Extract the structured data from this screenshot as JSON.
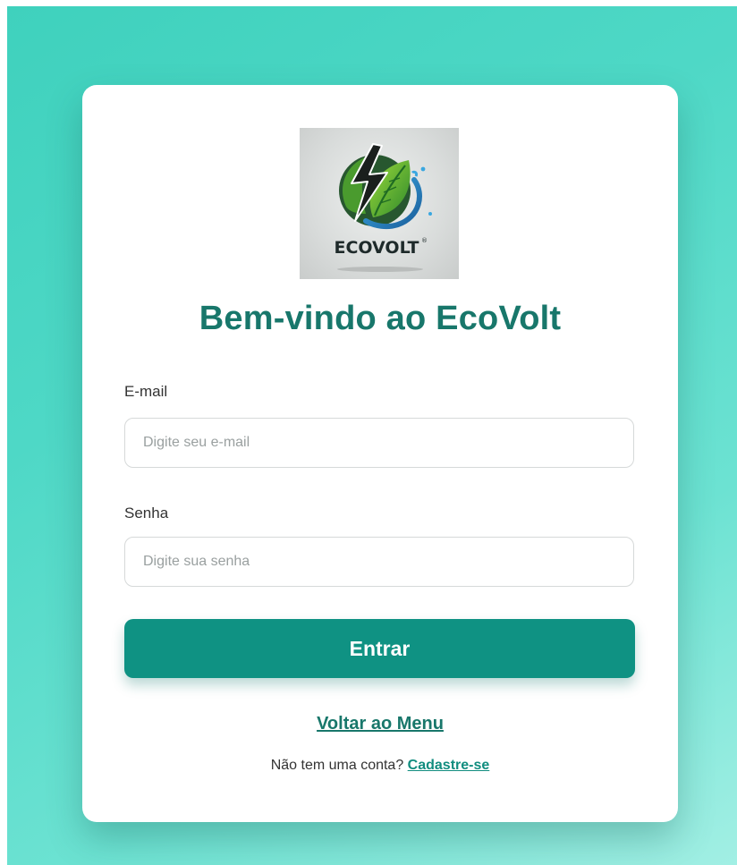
{
  "brand": {
    "logo_text": "ECOVOLT",
    "logo_mark": "®",
    "logo_icon": "leaf-lightning-globe-icon"
  },
  "title": "Bem-vindo ao EcoVolt",
  "form": {
    "email_label": "E-mail",
    "email_placeholder": "Digite seu e-mail",
    "email_value": "",
    "password_label": "Senha",
    "password_placeholder": "Digite sua senha",
    "password_value": "",
    "submit_label": "Entrar"
  },
  "links": {
    "back_label": "Voltar ao Menu",
    "signup_prompt": "Não tem uma conta? ",
    "signup_label": "Cadastre-se"
  },
  "colors": {
    "accent": "#0f9283",
    "title": "#18776b",
    "background_from": "#3fd1bd",
    "background_to": "#a2efe4"
  }
}
